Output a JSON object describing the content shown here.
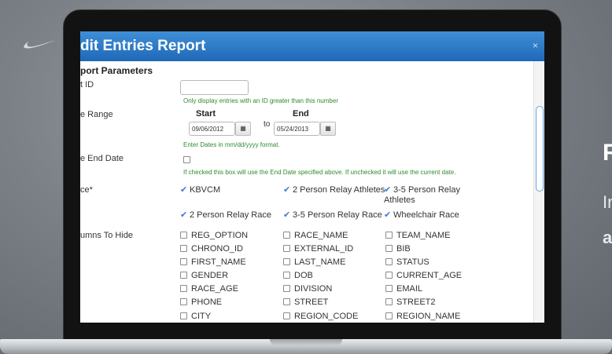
{
  "modal": {
    "title": "dit Entries Report",
    "close_glyph": "×",
    "section_title": "port Parameters"
  },
  "fields": {
    "id_label": "t ID",
    "id_help": "Only display entries with an ID greater than this number",
    "date_range_label": "e Range",
    "start_heading": "Start",
    "end_heading": "End",
    "to_label": "to",
    "start_date": "09/06/2012",
    "end_date": "05/24/2013",
    "date_help": "Enter Dates in mm/dd/yyyy format.",
    "use_end_date_label": "e End Date",
    "use_end_date_help": "If checked this box will use the End Date specified above. If unchecked it will use the current date.",
    "race_label": "ce*",
    "columns_label": "umns To Hide"
  },
  "races": [
    {
      "label": "KBVCM",
      "checked": true
    },
    {
      "label": "2 Person Relay Athletes",
      "checked": true
    },
    {
      "label": "3-5 Person Relay",
      "label2": "Athletes",
      "checked": true
    },
    {
      "label": "2 Person Relay Race",
      "checked": true
    },
    {
      "label": "3-5 Person Relay Race",
      "checked": true
    },
    {
      "label": "Wheelchair Race",
      "checked": true
    }
  ],
  "columns": [
    [
      "REG_OPTION",
      "RACE_NAME",
      "TEAM_NAME"
    ],
    [
      "CHRONO_ID",
      "EXTERNAL_ID",
      "BIB"
    ],
    [
      "FIRST_NAME",
      "LAST_NAME",
      "STATUS"
    ],
    [
      "GENDER",
      "DOB",
      "CURRENT_AGE"
    ],
    [
      "RACE_AGE",
      "DIVISION",
      "EMAIL"
    ],
    [
      "PHONE",
      "STREET",
      "STREET2"
    ],
    [
      "CITY",
      "REGION_CODE",
      "REGION_NAME"
    ]
  ],
  "icons": {
    "calendar": "calendar-icon",
    "check": "check-icon",
    "swoosh": "swoosh-logo"
  },
  "right_panel": {
    "heading": "R",
    "line1": "In",
    "line2": "a"
  },
  "colors": {
    "header_blue": "#2a78c6",
    "help_green": "#2f8a2f",
    "check_blue": "#3a7bd5"
  }
}
